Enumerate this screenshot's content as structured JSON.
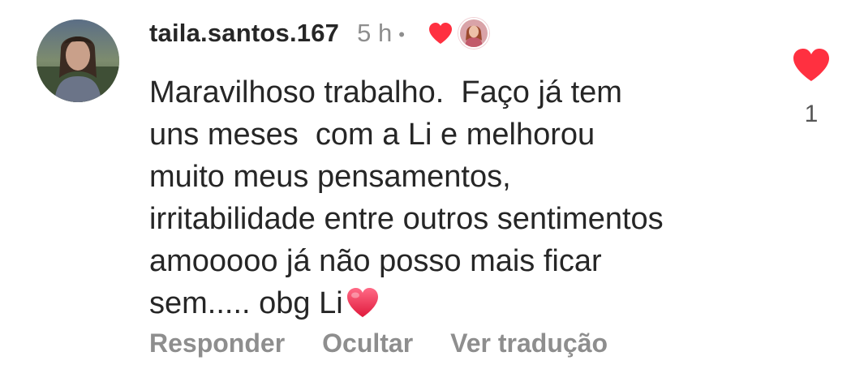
{
  "comment": {
    "username": "taila.santos.167",
    "timestamp": "5 h",
    "separator": "•",
    "body_lines": [
      "Maravilhoso trabalho.  Faço já tem",
      "uns meses  com a Li e melhorou",
      "muito meus pensamentos,",
      "irritabilidade entre outros sentimentos",
      "amooooo já não posso mais ficar",
      "sem..... obg Li"
    ],
    "body_trailing_emoji": "red-heart-emoji",
    "creator_liked_icon": "heart-icon",
    "like_count": "1",
    "actions": {
      "reply": "Responder",
      "hide": "Ocultar",
      "translate": "Ver tradução"
    }
  },
  "colors": {
    "like_red": "#ff3040",
    "secondary_text": "#8e8e8e",
    "primary_text": "#262626"
  }
}
